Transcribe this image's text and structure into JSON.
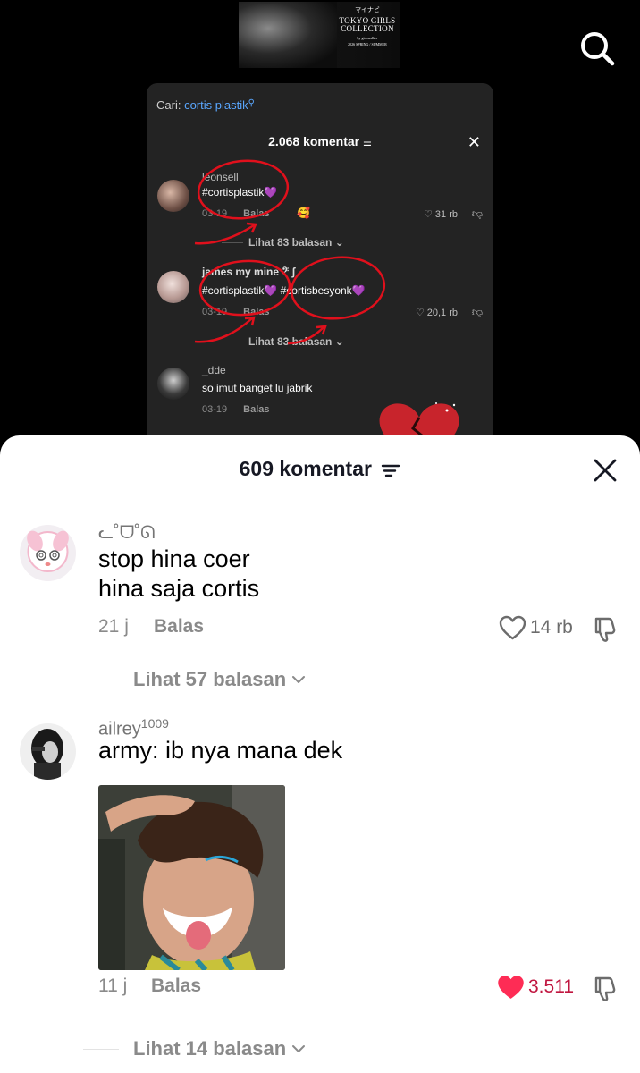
{
  "video": {
    "thumbnail": {
      "brand": "マイナビ",
      "line1": "TOKYO GIRLS",
      "line2": "COLLECTION",
      "line3": "by girlswalker",
      "line4": "2026 SPRING / SUMMER"
    },
    "search_icon": "search-icon",
    "embedded_panel": {
      "search_label": "Cari:",
      "search_keyword": "cortis plastik",
      "title": "2.068 komentar",
      "comments": [
        {
          "username": "leonsell",
          "text": "#cortisplastik💜",
          "date": "03-19",
          "reply": "Balas",
          "likes": "31 rb",
          "more": "Lihat 83 balasan ⌄"
        },
        {
          "username": "james my mine 𝄢 ʃ",
          "text": "#cortisplastik💜 #cortisbesyonk💜",
          "date": "03-19",
          "reply": "Balas",
          "likes": "20,1 rb",
          "more": "Lihat 83 balasan ⌄"
        },
        {
          "username": "_dde",
          "text": "so imut banget lu jabrik",
          "date": "03-19",
          "reply": "Balas"
        }
      ]
    }
  },
  "sheet": {
    "title": "609 komentar",
    "comments": [
      {
        "username": "ᓚ˚ᗜ˚ᘏ",
        "body_line1": "stop hina coer",
        "body_line2": "hina saja cortis",
        "time": "21 j",
        "reply": "Balas",
        "likes": "14 rb",
        "liked": false,
        "view_replies": "Lihat 57 balasan"
      },
      {
        "username": "ailrey",
        "username_sup": "1009",
        "body_line1": "army: ib nya mana dek",
        "has_image": true,
        "time": "11 j",
        "reply": "Balas",
        "likes": "3.511",
        "liked": true,
        "view_replies": "Lihat 14 balasan"
      }
    ]
  },
  "colors": {
    "like_active": "#fe2c55",
    "text_muted": "#8a8a8a",
    "link_blue": "#5aa7ff"
  }
}
